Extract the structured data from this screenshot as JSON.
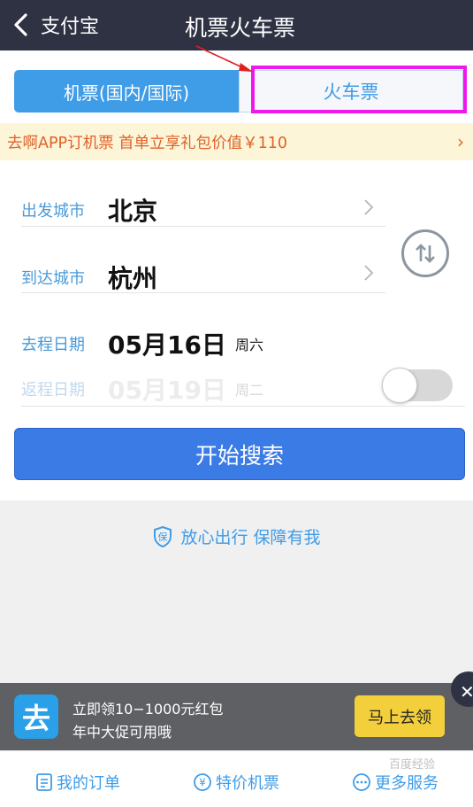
{
  "nav": {
    "back_label": "支付宝",
    "title": "机票火车票"
  },
  "tabs": {
    "flight": "机票(国内/国际)",
    "train": "火车票"
  },
  "promo": {
    "text": "去啊APP订机票 首单立享礼包价值￥110",
    "chevron": "›"
  },
  "form": {
    "depart_label": "出发城市",
    "depart_value": "北京",
    "arrive_label": "到达城市",
    "arrive_value": "杭州",
    "go_label": "去程日期",
    "go_date": "05月16日",
    "go_weekday": "周六",
    "return_label": "返程日期",
    "return_date": "05月19日",
    "return_weekday": "周二",
    "round_trip_enabled": false,
    "search_label": "开始搜索"
  },
  "slogan": {
    "text": "放心出行 保障有我"
  },
  "ad": {
    "logo_char": "去",
    "line1": "立即领10−1000元红包",
    "line2": "年中大促可用哦",
    "button": "马上去领",
    "close": "✕"
  },
  "bottom_bar": {
    "orders": "我的订单",
    "deals": "特价机票",
    "more": "更多服务"
  },
  "watermark": "百度经验",
  "colors": {
    "nav_bg": "#2e3243",
    "accent_blue": "#3f9ce7",
    "search_blue": "#3a7be6",
    "promo_bg": "#fcf5d8",
    "promo_text": "#e0622a",
    "highlight_magenta": "#ee18ee",
    "ad_bg": "#5e6064",
    "ad_button": "#f3cf3c"
  },
  "icons": {
    "back": "chevron-left-icon",
    "swap": "swap-arrows-icon",
    "slogan": "shield-icon",
    "orders": "document-icon",
    "deals": "yuan-circle-icon",
    "more": "more-dots-icon"
  }
}
